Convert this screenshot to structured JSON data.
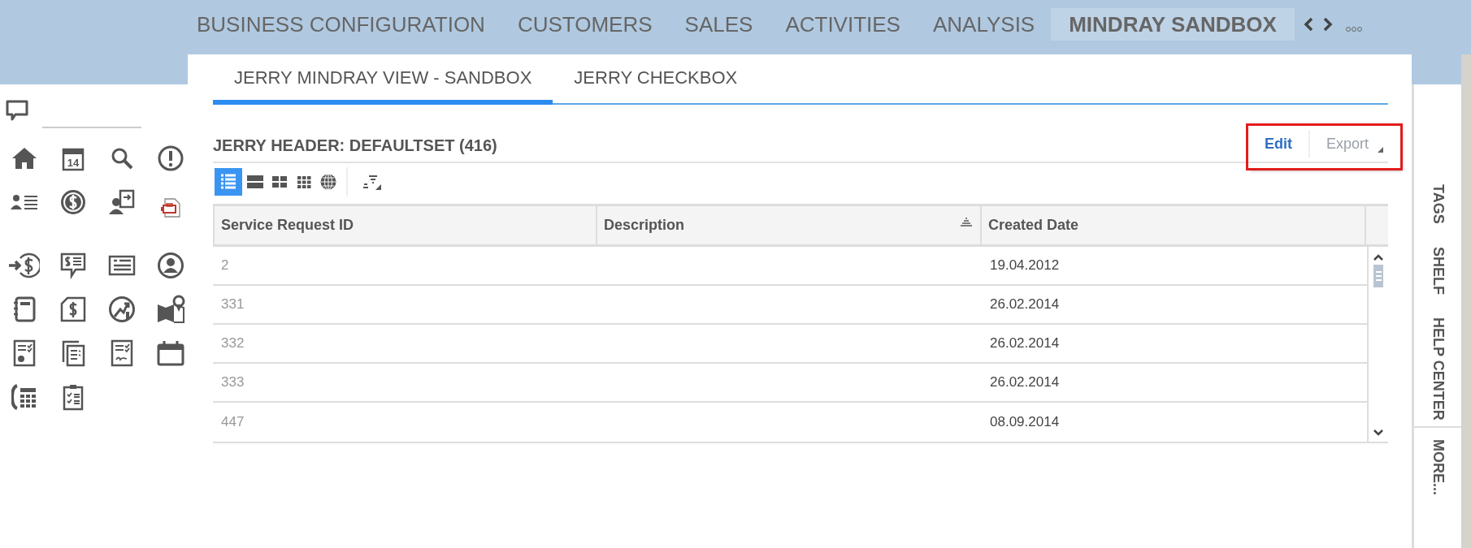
{
  "nav": {
    "tabs": [
      {
        "label": "BUSINESS CONFIGURATION",
        "selected": false
      },
      {
        "label": "CUSTOMERS",
        "selected": false
      },
      {
        "label": "SALES",
        "selected": false
      },
      {
        "label": "ACTIVITIES",
        "selected": false
      },
      {
        "label": "ANALYSIS",
        "selected": false
      },
      {
        "label": "MINDRAY SANDBOX",
        "selected": true
      }
    ]
  },
  "sidebar": {
    "calendar_day": "14"
  },
  "subtabs": [
    {
      "label": "JERRY MINDRAY VIEW - SANDBOX",
      "selected": true
    },
    {
      "label": "JERRY CHECKBOX",
      "selected": false
    }
  ],
  "list": {
    "title": "JERRY HEADER: DEFAULTSET (416)",
    "actions": [
      {
        "label": "Edit",
        "disabled": false,
        "menu": false
      },
      {
        "label": "Export",
        "disabled": true,
        "menu": true
      }
    ],
    "views": [
      {
        "selected": true
      },
      {
        "selected": false
      },
      {
        "selected": false
      },
      {
        "selected": false
      },
      {
        "selected": false
      }
    ],
    "columns": [
      {
        "label": "Service Request ID",
        "sorted": false
      },
      {
        "label": "Description",
        "sorted": true
      },
      {
        "label": "Created Date",
        "sorted": false
      }
    ],
    "rows": [
      {
        "id": "2",
        "created": "19.04.2012"
      },
      {
        "id": "331",
        "created": "26.02.2014"
      },
      {
        "id": "332",
        "created": "26.02.2014"
      },
      {
        "id": "333",
        "created": "26.02.2014"
      },
      {
        "id": "447",
        "created": "08.09.2014"
      }
    ]
  },
  "rail": {
    "tabs": [
      {
        "label": "TAGS"
      },
      {
        "label": "SHELF"
      },
      {
        "label": "HELP CENTER"
      }
    ],
    "more": "MORE..."
  }
}
